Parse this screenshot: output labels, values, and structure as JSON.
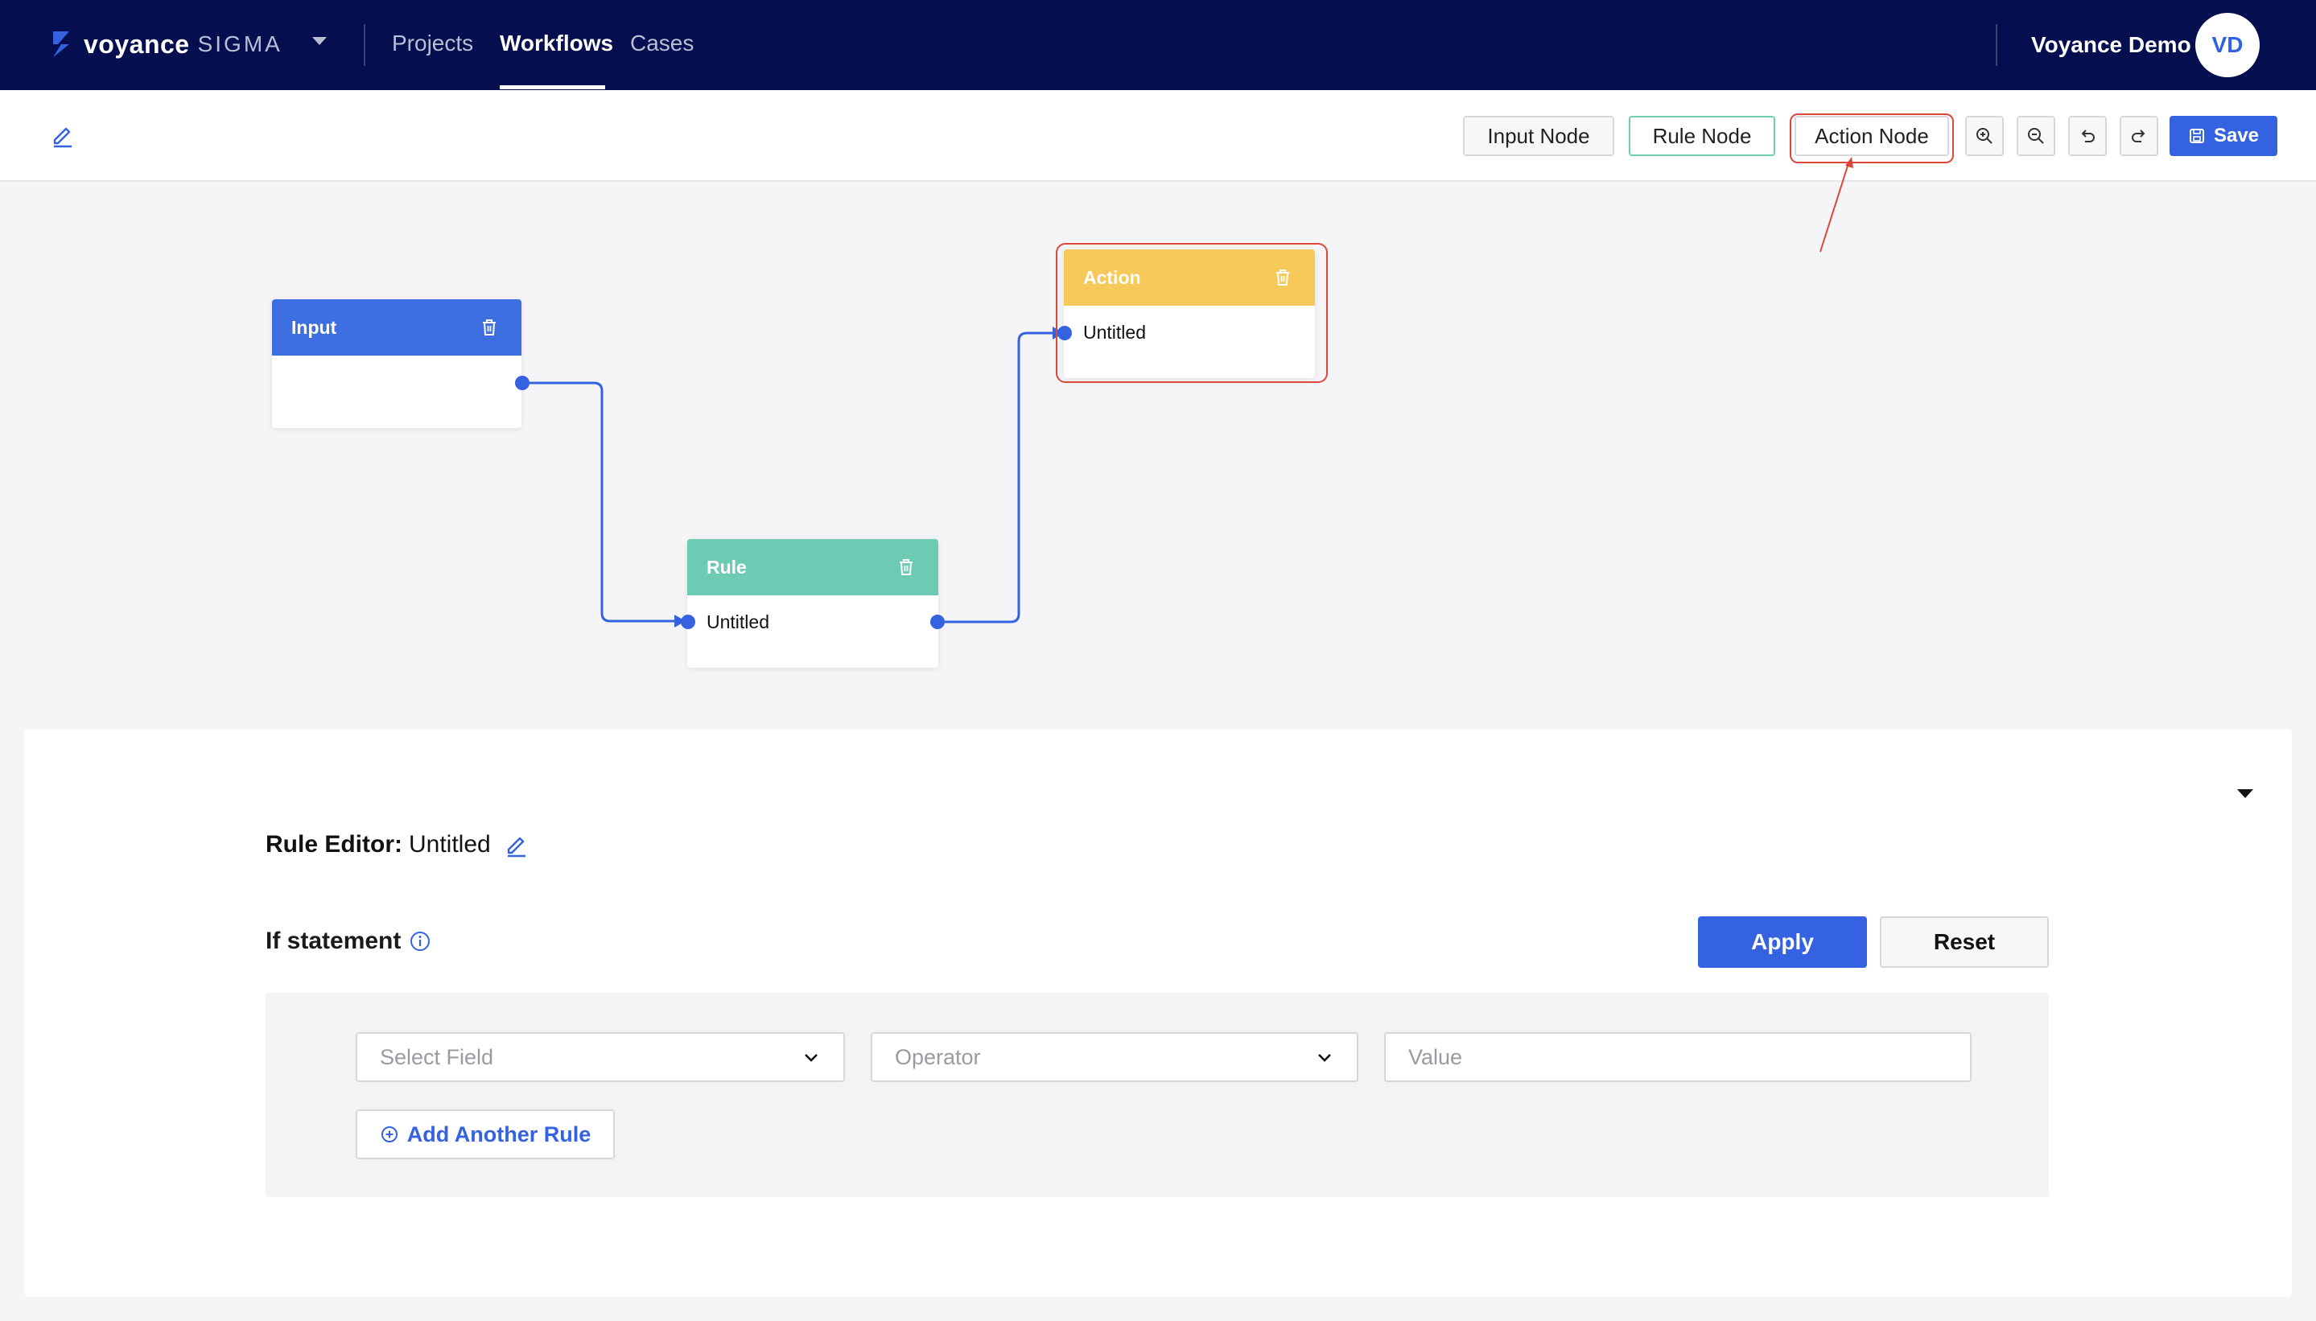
{
  "app": {
    "brand": "voyance",
    "product": "SIGMA",
    "nav": [
      {
        "label": "Projects"
      },
      {
        "label": "Workflows"
      },
      {
        "label": "Cases"
      }
    ],
    "user": {
      "name": "Voyance Demo",
      "initials": "VD"
    }
  },
  "toolbar": {
    "input_node": "Input Node",
    "rule_node": "Rule Node",
    "action_node": "Action Node",
    "save": "Save"
  },
  "nodes": {
    "input": {
      "title": "Input",
      "body": ""
    },
    "rule": {
      "title": "Rule",
      "body": "Untitled"
    },
    "action": {
      "title": "Action",
      "body": "Untitled"
    }
  },
  "editor": {
    "title_prefix": "Rule Editor:",
    "title_name": "Untitled",
    "if_label": "If statement",
    "apply": "Apply",
    "reset": "Reset",
    "select_field_placeholder": "Select Field",
    "operator_placeholder": "Operator",
    "value_placeholder": "Value",
    "add_rule": "Add Another Rule"
  },
  "colors": {
    "nav_bg": "#050e4e",
    "accent": "#3462e0",
    "input_node": "#3e6fe0",
    "rule_node": "#6dcbb3",
    "action_node": "#f7c85a",
    "highlight": "#e0453a"
  }
}
